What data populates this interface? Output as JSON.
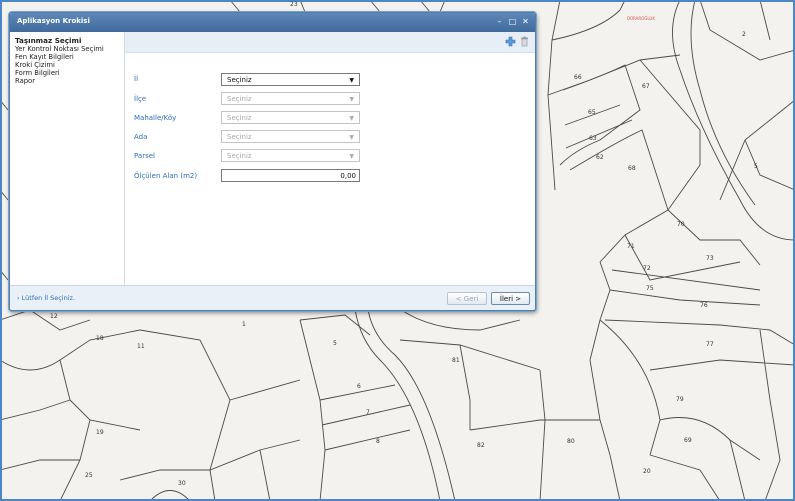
{
  "map": {
    "parcel_labels": [
      "2",
      "66",
      "67",
      "65",
      "63",
      "62",
      "68",
      "5",
      "70",
      "71",
      "73",
      "72",
      "75",
      "76",
      "77",
      "79",
      "69",
      "20",
      "80",
      "81",
      "82",
      "12",
      "1",
      "18",
      "11",
      "5",
      "6",
      "7",
      "8",
      "19",
      "25",
      "30",
      "23"
    ],
    "poi_label": "DÜRAROĞLUK"
  },
  "window": {
    "title": "Aplikasyon Krokisi",
    "controls": {
      "minimize_icon": "minimize-icon",
      "maximize_icon": "maximize-icon",
      "close_icon": "close-icon"
    }
  },
  "sidebar": {
    "items": [
      {
        "label": "Taşınmaz Seçimi",
        "active": true
      },
      {
        "label": "Yer Kontrol Noktası Seçimi"
      },
      {
        "label": "Fen Kayıt Bilgileri"
      },
      {
        "label": "Kroki Çizimi"
      },
      {
        "label": "Form Bilgileri"
      },
      {
        "label": "Rapor"
      }
    ]
  },
  "toolbar": {
    "add_icon": "plus-icon",
    "delete_icon": "trash-icon"
  },
  "form": {
    "il": {
      "label": "İl",
      "value": "Seçiniz"
    },
    "ilce": {
      "label": "İlçe",
      "value": "Seçiniz"
    },
    "mahalle": {
      "label": "Mahalle/Köy",
      "value": "Seçiniz"
    },
    "ada": {
      "label": "Ada",
      "value": "Seçiniz"
    },
    "parsel": {
      "label": "Parsel",
      "value": "Seçiniz"
    },
    "alan": {
      "label": "Ölçülen Alan (m2)",
      "value": "0,00"
    }
  },
  "footer": {
    "status": "Lütfen İl Seçiniz.",
    "back_label": "< Geri",
    "next_label": "İleri >"
  },
  "colors": {
    "accent": "#3f6a9b",
    "label_blue": "#2f6db5",
    "map_bg": "#f3f2ee",
    "frame": "#4a86c8"
  }
}
